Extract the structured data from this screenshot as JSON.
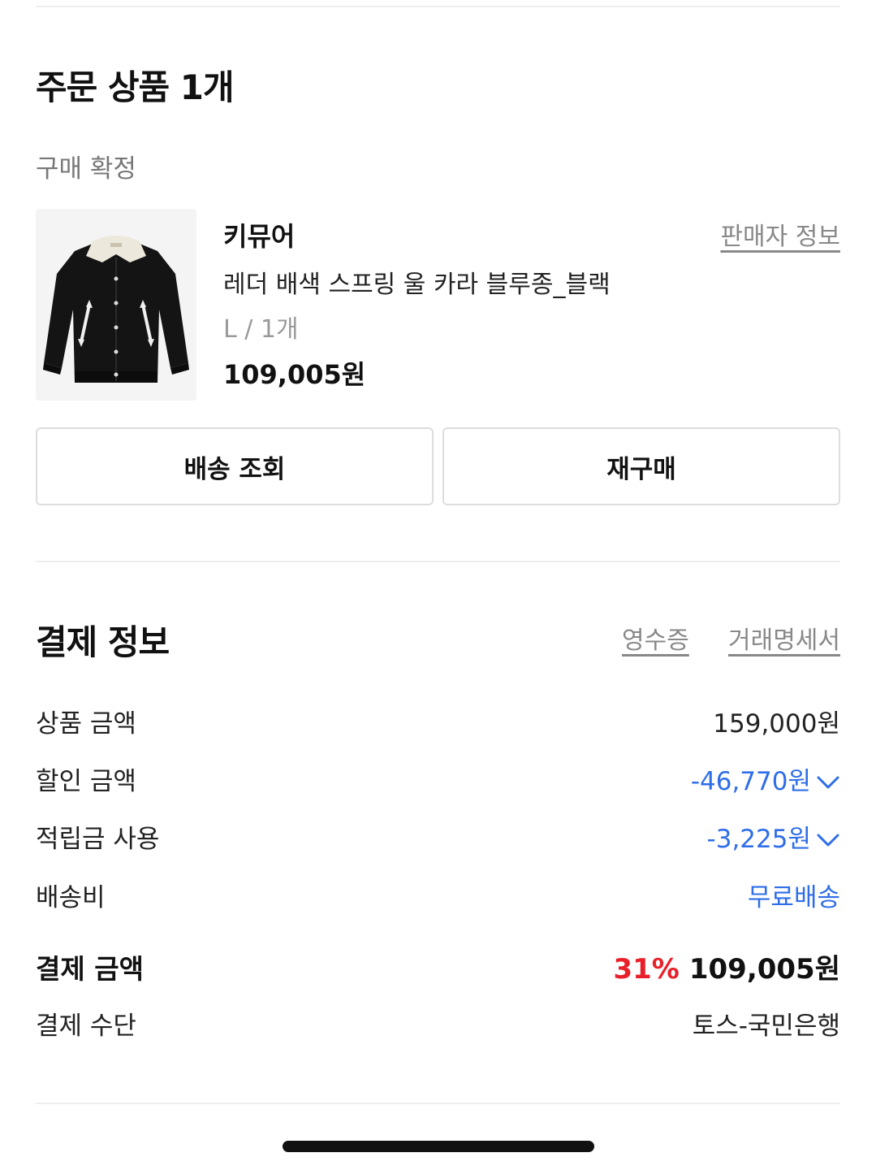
{
  "order": {
    "title": "주문 상품 1개",
    "status": "구매 확정",
    "product": {
      "brand": "키뮤어",
      "name": "레더 배색 스프링 울 카라 블루종_블랙",
      "option": "L / 1개",
      "price": "109,005원",
      "seller_link": "판매자 정보",
      "image_icon": "jacket-image"
    },
    "buttons": {
      "tracking": "배송 조회",
      "rebuy": "재구매"
    }
  },
  "payment": {
    "title": "결제 정보",
    "receipt_link": "영수증",
    "statement_link": "거래명세서",
    "rows": {
      "product_amount": {
        "label": "상품 금액",
        "value": "159,000원"
      },
      "discount": {
        "label": "할인 금액",
        "value": "-46,770원"
      },
      "points": {
        "label": "적립금 사용",
        "value": "-3,225원"
      },
      "shipping": {
        "label": "배송비",
        "value": "무료배송"
      },
      "total": {
        "label": "결제 금액",
        "percent": "31%",
        "value": "109,005원"
      },
      "method": {
        "label": "결제 수단",
        "value": "토스-국민은행"
      }
    }
  },
  "colors": {
    "accent_blue": "#2f6ee8",
    "accent_red": "#e8202a",
    "divider": "#eeeeee"
  }
}
